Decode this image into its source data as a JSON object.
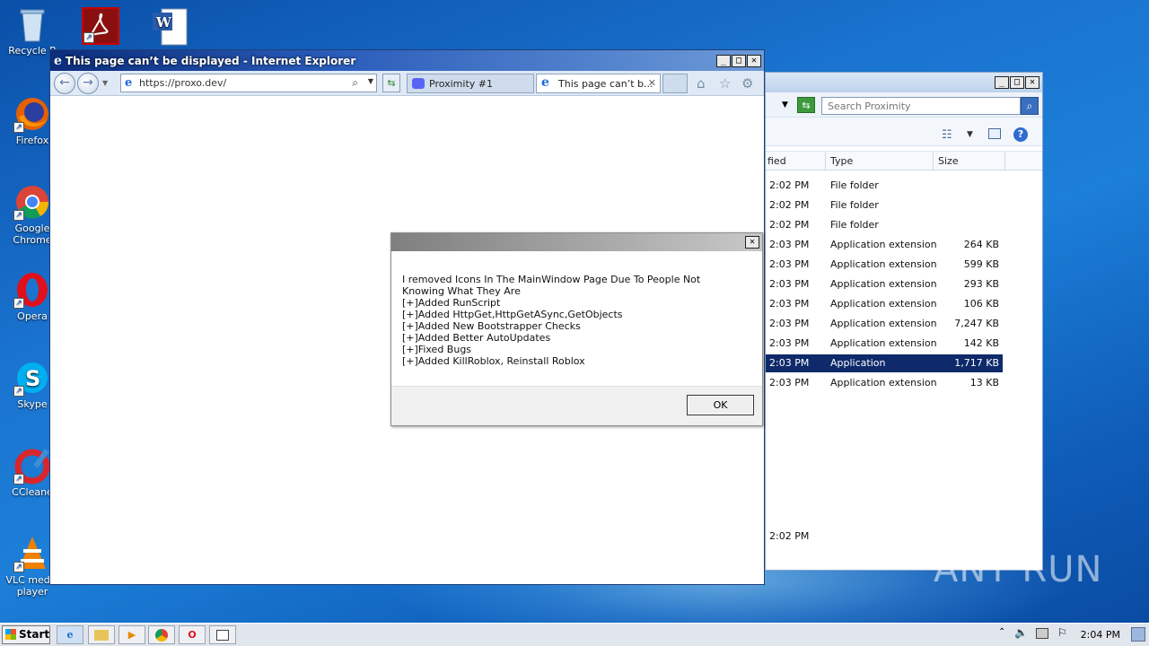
{
  "desktop": {
    "icons": [
      {
        "label": "Recycle B",
        "icon": "recycle-bin-icon"
      },
      {
        "label": "Firefox",
        "icon": "firefox-icon"
      },
      {
        "label": "Google Chrome",
        "icon": "chrome-icon"
      },
      {
        "label": "Opera",
        "icon": "opera-icon"
      },
      {
        "label": "Skype",
        "icon": "skype-icon"
      },
      {
        "label": "CCleane",
        "icon": "ccleaner-icon"
      },
      {
        "label": "VLC media player",
        "icon": "vlc-icon"
      }
    ],
    "watermark": "ANY RUN"
  },
  "explorer": {
    "search_placeholder": "Search Proximity",
    "columns": {
      "modified": "fied",
      "type": "Type",
      "size": "Size"
    },
    "rows": [
      {
        "time": "2:02 PM",
        "type": "File folder",
        "size": ""
      },
      {
        "time": "2:02 PM",
        "type": "File folder",
        "size": ""
      },
      {
        "time": "2:02 PM",
        "type": "File folder",
        "size": ""
      },
      {
        "time": "2:03 PM",
        "type": "Application extension",
        "size": "264 KB"
      },
      {
        "time": "2:03 PM",
        "type": "Application extension",
        "size": "599 KB"
      },
      {
        "time": "2:03 PM",
        "type": "Application extension",
        "size": "293 KB"
      },
      {
        "time": "2:03 PM",
        "type": "Application extension",
        "size": "106 KB"
      },
      {
        "time": "2:03 PM",
        "type": "Application extension",
        "size": "7,247 KB"
      },
      {
        "time": "2:03 PM",
        "type": "Application extension",
        "size": "142 KB"
      },
      {
        "time": "2:03 PM",
        "type": "Application",
        "size": "1,717 KB",
        "selected": true
      },
      {
        "time": "2:03 PM",
        "type": "Application extension",
        "size": "13 KB"
      }
    ],
    "status_time": "2:02 PM"
  },
  "ie": {
    "title": "This page can’t be displayed - Internet Explorer",
    "url": "https://proxo.dev/",
    "tabs": [
      {
        "label": "Proximity #1"
      },
      {
        "label": "This page can’t b..."
      }
    ]
  },
  "msgbox": {
    "text": "I removed Icons In The MainWindow Page Due To People Not Knowing What They Are\n[+]Added RunScript\n[+]Added HttpGet,HttpGetASync,GetObjects\n[+]Added New Bootstrapper Checks\n[+]Added Better AutoUpdates\n[+]Fixed Bugs\n[+]Added KillRoblox, Reinstall Roblox",
    "ok_label": "OK"
  },
  "taskbar": {
    "start_label": "Start",
    "clock": "2:04 PM"
  }
}
